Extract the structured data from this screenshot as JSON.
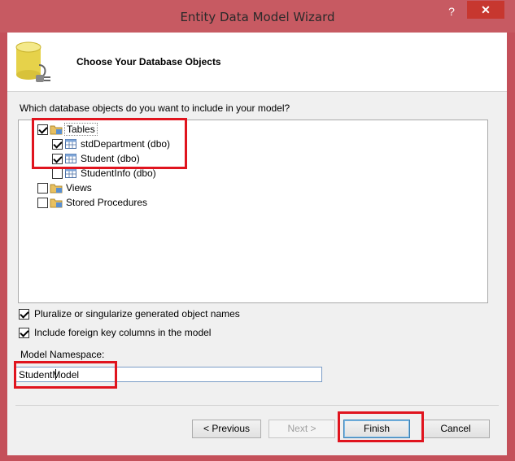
{
  "window": {
    "title": "Entity Data Model Wizard",
    "help_glyph": "?",
    "close_glyph": "✕"
  },
  "header": {
    "title": "Choose Your Database Objects",
    "icon": "database-plug-icon"
  },
  "question": "Which database objects do you want to include in your model?",
  "tree": {
    "nodes": [
      {
        "label": "Tables",
        "checked": true,
        "icon": "folder-icon",
        "level": 0
      },
      {
        "label": "stdDepartment (dbo)",
        "checked": true,
        "icon": "table-icon",
        "level": 1
      },
      {
        "label": "Student (dbo)",
        "checked": true,
        "icon": "table-icon",
        "level": 1
      },
      {
        "label": "StudentInfo (dbo)",
        "checked": false,
        "icon": "table-icon",
        "level": 1
      },
      {
        "label": "Views",
        "checked": false,
        "icon": "folder-icon",
        "level": 0
      },
      {
        "label": "Stored Procedures",
        "checked": false,
        "icon": "folder-icon",
        "level": 0
      }
    ]
  },
  "options": {
    "pluralize": {
      "label": "Pluralize or singularize generated object names",
      "checked": true
    },
    "foreign_keys": {
      "label": "Include foreign key columns in the model",
      "checked": true
    }
  },
  "namespace": {
    "label": "Model Namespace:",
    "value": "StudentModel"
  },
  "buttons": {
    "previous": "< Previous",
    "next": "Next >",
    "finish": "Finish",
    "cancel": "Cancel"
  },
  "colors": {
    "title_bar": "#c75a62",
    "close_button": "#c7372f",
    "highlight": "#e0141e",
    "dialog_bg": "#f0f0f0"
  }
}
